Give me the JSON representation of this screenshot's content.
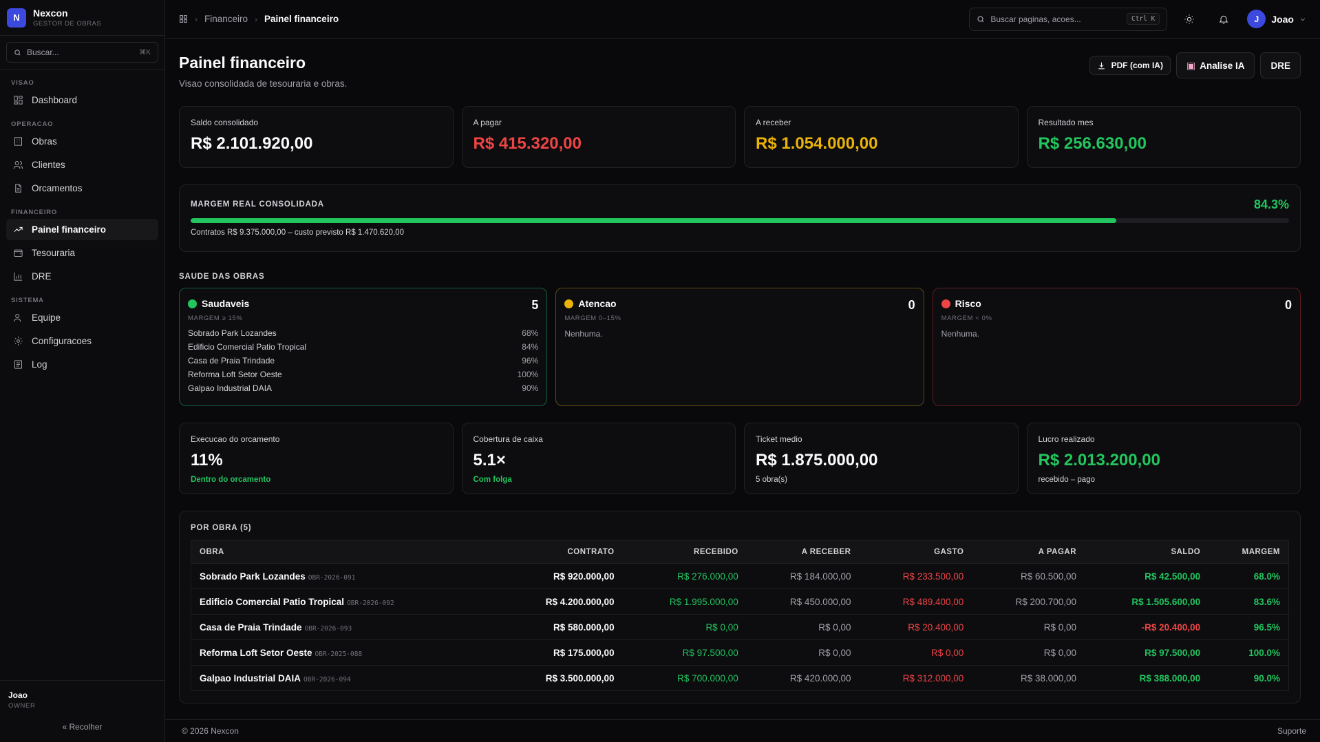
{
  "brand": {
    "initial": "N",
    "name": "Nexcon",
    "subtitle": "GESTOR DE OBRAS",
    "color": "#3b49df"
  },
  "sidebar": {
    "search_placeholder": "Buscar...",
    "search_shortcut": "⌘K",
    "sections": [
      {
        "label": "VISAO",
        "items": [
          {
            "label": "Dashboard",
            "icon": "grid-icon"
          }
        ]
      },
      {
        "label": "OPERACAO",
        "items": [
          {
            "label": "Obras",
            "icon": "building-icon"
          },
          {
            "label": "Clientes",
            "icon": "users-icon"
          },
          {
            "label": "Orcamentos",
            "icon": "file-icon"
          }
        ]
      },
      {
        "label": "FINANCEIRO",
        "items": [
          {
            "label": "Painel financeiro",
            "icon": "trending-up-icon",
            "active": true
          },
          {
            "label": "Tesouraria",
            "icon": "wallet-icon"
          },
          {
            "label": "DRE",
            "icon": "bar-chart-icon"
          }
        ]
      },
      {
        "label": "SISTEMA",
        "items": [
          {
            "label": "Equipe",
            "icon": "user-icon"
          },
          {
            "label": "Configuracoes",
            "icon": "gear-icon"
          },
          {
            "label": "Log",
            "icon": "log-icon"
          }
        ]
      }
    ],
    "user": {
      "name": "Joao",
      "role": "OWNER"
    },
    "collapse_label": "Recolher"
  },
  "topbar": {
    "breadcrumb": [
      "Financeiro",
      "Painel financeiro"
    ],
    "search_placeholder": "Buscar paginas, acoes...",
    "search_shortcut": "Ctrl K",
    "user_initial": "J",
    "user_name": "Joao"
  },
  "page": {
    "title": "Painel financeiro",
    "subtitle": "Visao consolidada de tesouraria e obras.",
    "actions": {
      "pdf": "PDF (com IA)",
      "ai": "Analise IA",
      "dre": "DRE"
    }
  },
  "kpis": [
    {
      "label": "Saldo consolidado",
      "value": "R$ 2.101.920,00",
      "color": "#fafafa"
    },
    {
      "label": "A pagar",
      "value": "R$ 415.320,00",
      "color": "#ef4444"
    },
    {
      "label": "A receber",
      "value": "R$ 1.054.000,00",
      "color": "#eab308"
    },
    {
      "label": "Resultado mes",
      "value": "R$ 256.630,00",
      "color": "#22c55e"
    }
  ],
  "margin": {
    "title": "MARGEM REAL CONSOLIDADA",
    "percent_label": "84.3%",
    "fraction": 0.843,
    "footnote": "Contratos R$ 9.375.000,00 – custo previsto R$ 1.470.620,00"
  },
  "health": {
    "title": "SAUDE DAS OBRAS",
    "groups": [
      {
        "name": "Saudaveis",
        "count": "5",
        "range": "MARGEM ≥ 15%",
        "dot": "#22c55e",
        "items": [
          {
            "name": "Sobrado Park Lozandes",
            "pct": "68%"
          },
          {
            "name": "Edificio Comercial Patio Tropical",
            "pct": "84%"
          },
          {
            "name": "Casa de Praia Trindade",
            "pct": "96%"
          },
          {
            "name": "Reforma Loft Setor Oeste",
            "pct": "100%"
          },
          {
            "name": "Galpao Industrial DAIA",
            "pct": "90%"
          }
        ]
      },
      {
        "name": "Atencao",
        "count": "0",
        "range": "MARGEM 0–15%",
        "dot": "#eab308",
        "empty": "Nenhuma."
      },
      {
        "name": "Risco",
        "count": "0",
        "range": "MARGEM < 0%",
        "dot": "#ef4444",
        "empty": "Nenhuma."
      }
    ]
  },
  "kpis2": [
    {
      "label": "Execucao do orcamento",
      "value": "11%",
      "sub": "Dentro do orcamento",
      "sub_green": true,
      "color": "#fafafa"
    },
    {
      "label": "Cobertura de caixa",
      "value": "5.1×",
      "sub": "Com folga",
      "sub_green": true,
      "color": "#fafafa"
    },
    {
      "label": "Ticket medio",
      "value": "R$ 1.875.000,00",
      "sub": "5 obra(s)",
      "sub_green": false,
      "color": "#fafafa"
    },
    {
      "label": "Lucro realizado",
      "value": "R$ 2.013.200,00",
      "sub": "recebido – pago",
      "sub_green": false,
      "color": "#22c55e"
    }
  ],
  "table": {
    "title": "POR OBRA (5)",
    "columns": [
      "OBRA",
      "CONTRATO",
      "RECEBIDO",
      "A RECEBER",
      "GASTO",
      "A PAGAR",
      "SALDO",
      "MARGEM"
    ],
    "rows": [
      {
        "name": "Sobrado Park Lozandes",
        "code": "OBR-2026-091",
        "contrato": "R$ 920.000,00",
        "recebido": "R$ 276.000,00",
        "a_receber": "R$ 184.000,00",
        "gasto": "R$ 233.500,00",
        "a_pagar": "R$ 60.500,00",
        "saldo": "R$ 42.500,00",
        "margem": "68.0%",
        "saldo_neg": false
      },
      {
        "name": "Edificio Comercial Patio Tropical",
        "code": "OBR-2026-092",
        "contrato": "R$ 4.200.000,00",
        "recebido": "R$ 1.995.000,00",
        "a_receber": "R$ 450.000,00",
        "gasto": "R$ 489.400,00",
        "a_pagar": "R$ 200.700,00",
        "saldo": "R$ 1.505.600,00",
        "margem": "83.6%",
        "saldo_neg": false
      },
      {
        "name": "Casa de Praia Trindade",
        "code": "OBR-2026-093",
        "contrato": "R$ 580.000,00",
        "recebido": "R$ 0,00",
        "a_receber": "R$ 0,00",
        "gasto": "R$ 20.400,00",
        "a_pagar": "R$ 0,00",
        "saldo": "-R$ 20.400,00",
        "margem": "96.5%",
        "saldo_neg": true
      },
      {
        "name": "Reforma Loft Setor Oeste",
        "code": "OBR-2025-088",
        "contrato": "R$ 175.000,00",
        "recebido": "R$ 97.500,00",
        "a_receber": "R$ 0,00",
        "gasto": "R$ 0,00",
        "a_pagar": "R$ 0,00",
        "saldo": "R$ 97.500,00",
        "margem": "100.0%",
        "saldo_neg": false
      },
      {
        "name": "Galpao Industrial DAIA",
        "code": "OBR-2026-094",
        "contrato": "R$ 3.500.000,00",
        "recebido": "R$ 700.000,00",
        "a_receber": "R$ 420.000,00",
        "gasto": "R$ 312.000,00",
        "a_pagar": "R$ 38.000,00",
        "saldo": "R$ 388.000,00",
        "margem": "90.0%",
        "saldo_neg": false
      }
    ]
  },
  "footer": {
    "copyright": "© 2026 Nexcon",
    "support": "Suporte"
  }
}
